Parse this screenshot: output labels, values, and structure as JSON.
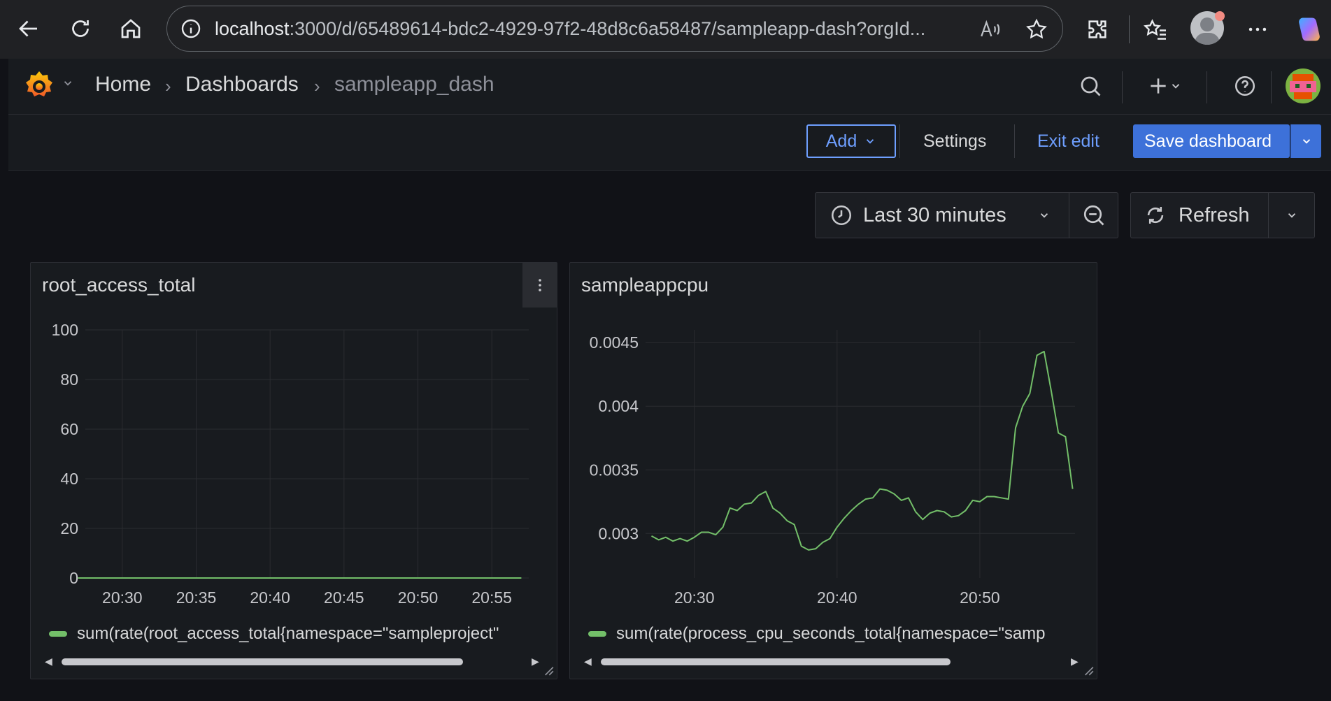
{
  "browser": {
    "url_host": "localhost",
    "url_path": ":3000/d/65489614-bdc2-4929-97f2-48d8c6a58487/sampleapp-dash?orgId..."
  },
  "header": {
    "breadcrumbs": [
      "Home",
      "Dashboards",
      "sampleapp_dash"
    ]
  },
  "toolbar": {
    "add_label": "Add",
    "settings_label": "Settings",
    "exit_edit_label": "Exit edit",
    "save_label": "Save dashboard"
  },
  "time_picker": {
    "range_label": "Last 30 minutes",
    "refresh_label": "Refresh"
  },
  "colors": {
    "series": "#73bf69",
    "primary": "#3d71d9",
    "accent_text": "#6e9fff"
  },
  "panels": [
    {
      "title": "root_access_total",
      "legend": "sum(rate(root_access_total{namespace=\"sampleproject\""
    },
    {
      "title": "sampleappcpu",
      "legend": "sum(rate(process_cpu_seconds_total{namespace=\"samp"
    }
  ],
  "chart_data": [
    {
      "type": "line",
      "title": "root_access_total",
      "x_ticks": [
        "20:30",
        "20:35",
        "20:40",
        "20:45",
        "20:50",
        "20:55"
      ],
      "y_ticks": [
        "0",
        "20",
        "40",
        "60",
        "80",
        "100"
      ],
      "ylim": [
        0,
        100
      ],
      "series": [
        {
          "name": "sum(rate(root_access_total{namespace=\"sampleproject\"",
          "x": [
            "20:27",
            "20:57"
          ],
          "values": [
            0,
            0
          ]
        }
      ]
    },
    {
      "type": "line",
      "title": "sampleappcpu",
      "x_ticks": [
        "20:30",
        "20:40",
        "20:50"
      ],
      "y_ticks": [
        "0.003",
        "0.0035",
        "0.004",
        "0.0045"
      ],
      "ylim": [
        0.00265,
        0.0046
      ],
      "series": [
        {
          "name": "sum(rate(process_cpu_seconds_total{namespace=\"samp",
          "x": [
            "20:27:00",
            "20:27:30",
            "20:28:00",
            "20:28:30",
            "20:29:00",
            "20:29:30",
            "20:30:00",
            "20:30:30",
            "20:31:00",
            "20:31:30",
            "20:32:00",
            "20:32:30",
            "20:33:00",
            "20:33:30",
            "20:34:00",
            "20:34:30",
            "20:35:00",
            "20:35:30",
            "20:36:00",
            "20:36:30",
            "20:37:00",
            "20:37:30",
            "20:38:00",
            "20:38:30",
            "20:39:00",
            "20:39:30",
            "20:40:00",
            "20:40:30",
            "20:41:00",
            "20:41:30",
            "20:42:00",
            "20:42:30",
            "20:43:00",
            "20:43:30",
            "20:44:00",
            "20:44:30",
            "20:45:00",
            "20:45:30",
            "20:46:00",
            "20:46:30",
            "20:47:00",
            "20:47:30",
            "20:48:00",
            "20:48:30",
            "20:49:00",
            "20:49:30",
            "20:50:00",
            "20:50:30",
            "20:51:00",
            "20:51:30",
            "20:52:00",
            "20:52:30",
            "20:53:00",
            "20:53:30",
            "20:54:00",
            "20:54:30",
            "20:55:00",
            "20:55:30",
            "20:56:00",
            "20:56:30"
          ],
          "values": [
            0.00298,
            0.00295,
            0.00297,
            0.00294,
            0.00296,
            0.00294,
            0.00297,
            0.00301,
            0.00301,
            0.00299,
            0.00305,
            0.0032,
            0.00318,
            0.00323,
            0.00324,
            0.0033,
            0.00333,
            0.0032,
            0.00316,
            0.0031,
            0.00307,
            0.0029,
            0.00287,
            0.00288,
            0.00293,
            0.00296,
            0.00305,
            0.00312,
            0.00318,
            0.00323,
            0.00327,
            0.00328,
            0.00335,
            0.00334,
            0.00331,
            0.00326,
            0.00328,
            0.00317,
            0.00311,
            0.00316,
            0.00318,
            0.00317,
            0.00313,
            0.00314,
            0.00318,
            0.00326,
            0.00325,
            0.00329,
            0.00329,
            0.00328,
            0.00327,
            0.00383,
            0.004,
            0.0041,
            0.0044,
            0.00443,
            0.00412,
            0.00379,
            0.00376,
            0.00335
          ]
        }
      ]
    }
  ]
}
